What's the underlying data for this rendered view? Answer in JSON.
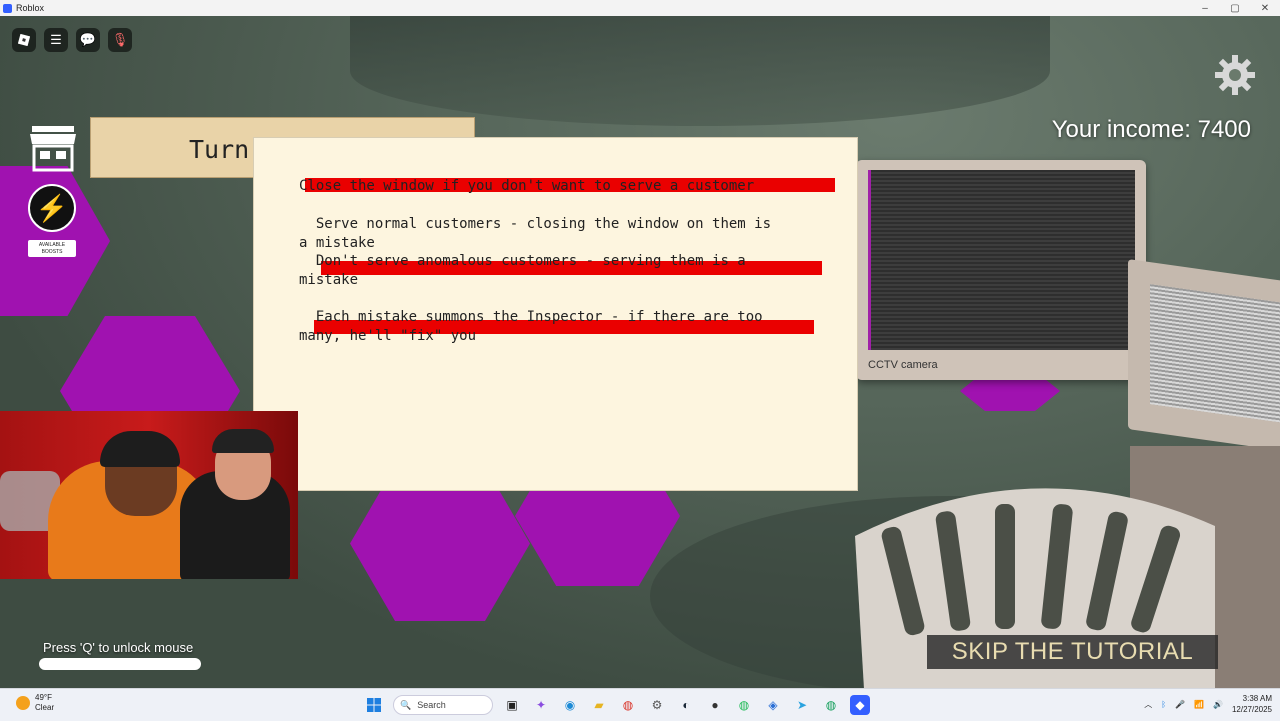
{
  "window": {
    "title": "Roblox"
  },
  "hud": {
    "boost_label": "AVAILABLE BOOSTS",
    "income": "Your income: 7400",
    "turn_panel_text": "Turn",
    "unlock_hint": "Press 'Q' to unlock mouse",
    "skip_button": "SKIP THE TUTORIAL"
  },
  "tutorial": {
    "line1": "Close the window if you don't want to serve a customer",
    "line2": "  Serve normal customers - closing the window on them is\na mistake",
    "line3": "  Don't serve anomalous customers - serving them is a\nmistake",
    "line4": "  Each mistake summons the Inspector - if there are too\nmany, he'll \"fix\" you",
    "redacted_color": "#ea0000"
  },
  "scene": {
    "cctv_label": "CCTV camera",
    "hex_color": "#a012b0"
  },
  "taskbar": {
    "weather_temp": "49°F",
    "weather_cond": "Clear",
    "search_placeholder": "Search",
    "time": "3:38 AM",
    "date": "12/27/2025"
  }
}
